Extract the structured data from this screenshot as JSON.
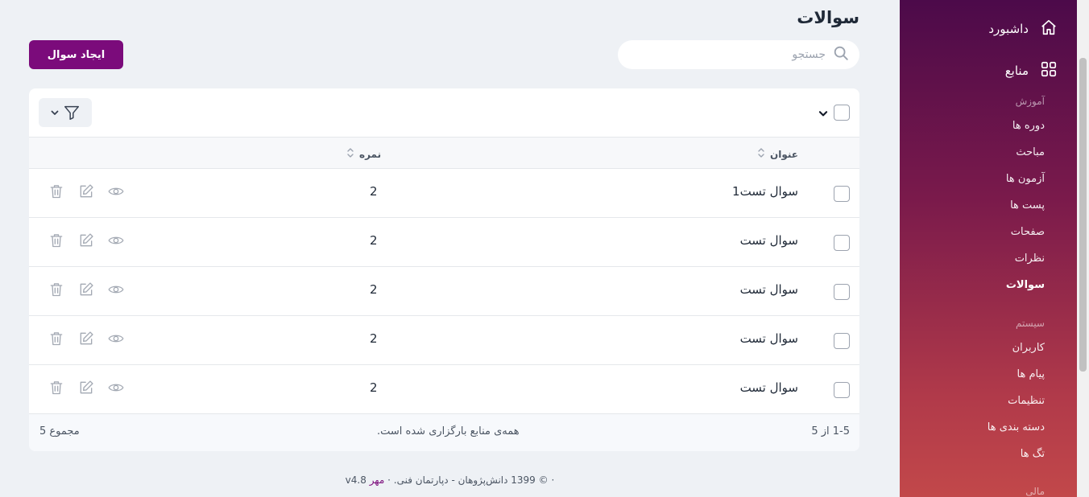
{
  "header": {
    "title": "سوالات",
    "search_placeholder": "جستجو",
    "create_button": "ایجاد سوال"
  },
  "sidebar": {
    "dashboard": "داشبورد",
    "resources": "منابع",
    "groups": [
      {
        "heading": "آموزش",
        "items": [
          "دوره ها",
          "مباحث",
          "آزمون ها",
          "پست ها",
          "صفحات",
          "نظرات",
          "سوالات"
        ]
      },
      {
        "heading": "سیستم",
        "items": [
          "کاربران",
          "پیام ها",
          "تنظیمات",
          "دسته بندی ها",
          "تگ ها"
        ]
      },
      {
        "heading": "مالی",
        "items": []
      }
    ],
    "active_item": "سوالات"
  },
  "table": {
    "columns": {
      "title": "عنوان",
      "score": "نمره"
    },
    "rows": [
      {
        "title": "سوال تست1",
        "score": "2"
      },
      {
        "title": "سوال تست",
        "score": "2"
      },
      {
        "title": "سوال تست",
        "score": "2"
      },
      {
        "title": "سوال تست",
        "score": "2"
      },
      {
        "title": "سوال تست",
        "score": "2"
      }
    ],
    "footer": {
      "range": "1-5 از 5",
      "status": "همه‌ی منابع بارگزاری شده است.",
      "total": "مجموع 5"
    }
  },
  "footer": {
    "copyright": "© 1399 دانش‌پژوهان - دپارتمان فنی.",
    "brand": "مهر",
    "version": "v4.8"
  },
  "colors": {
    "primary": "#7b0b7b",
    "sidebar_top": "#4c0a4a",
    "sidebar_bottom": "#c2484a",
    "background": "#eef1f5"
  },
  "icons": {
    "dashboard": "home-icon",
    "resources": "grid-icon",
    "search": "search-icon",
    "filter": "filter-icon",
    "row_actions": [
      "view-eye-icon",
      "edit-icon",
      "trash-icon"
    ]
  }
}
